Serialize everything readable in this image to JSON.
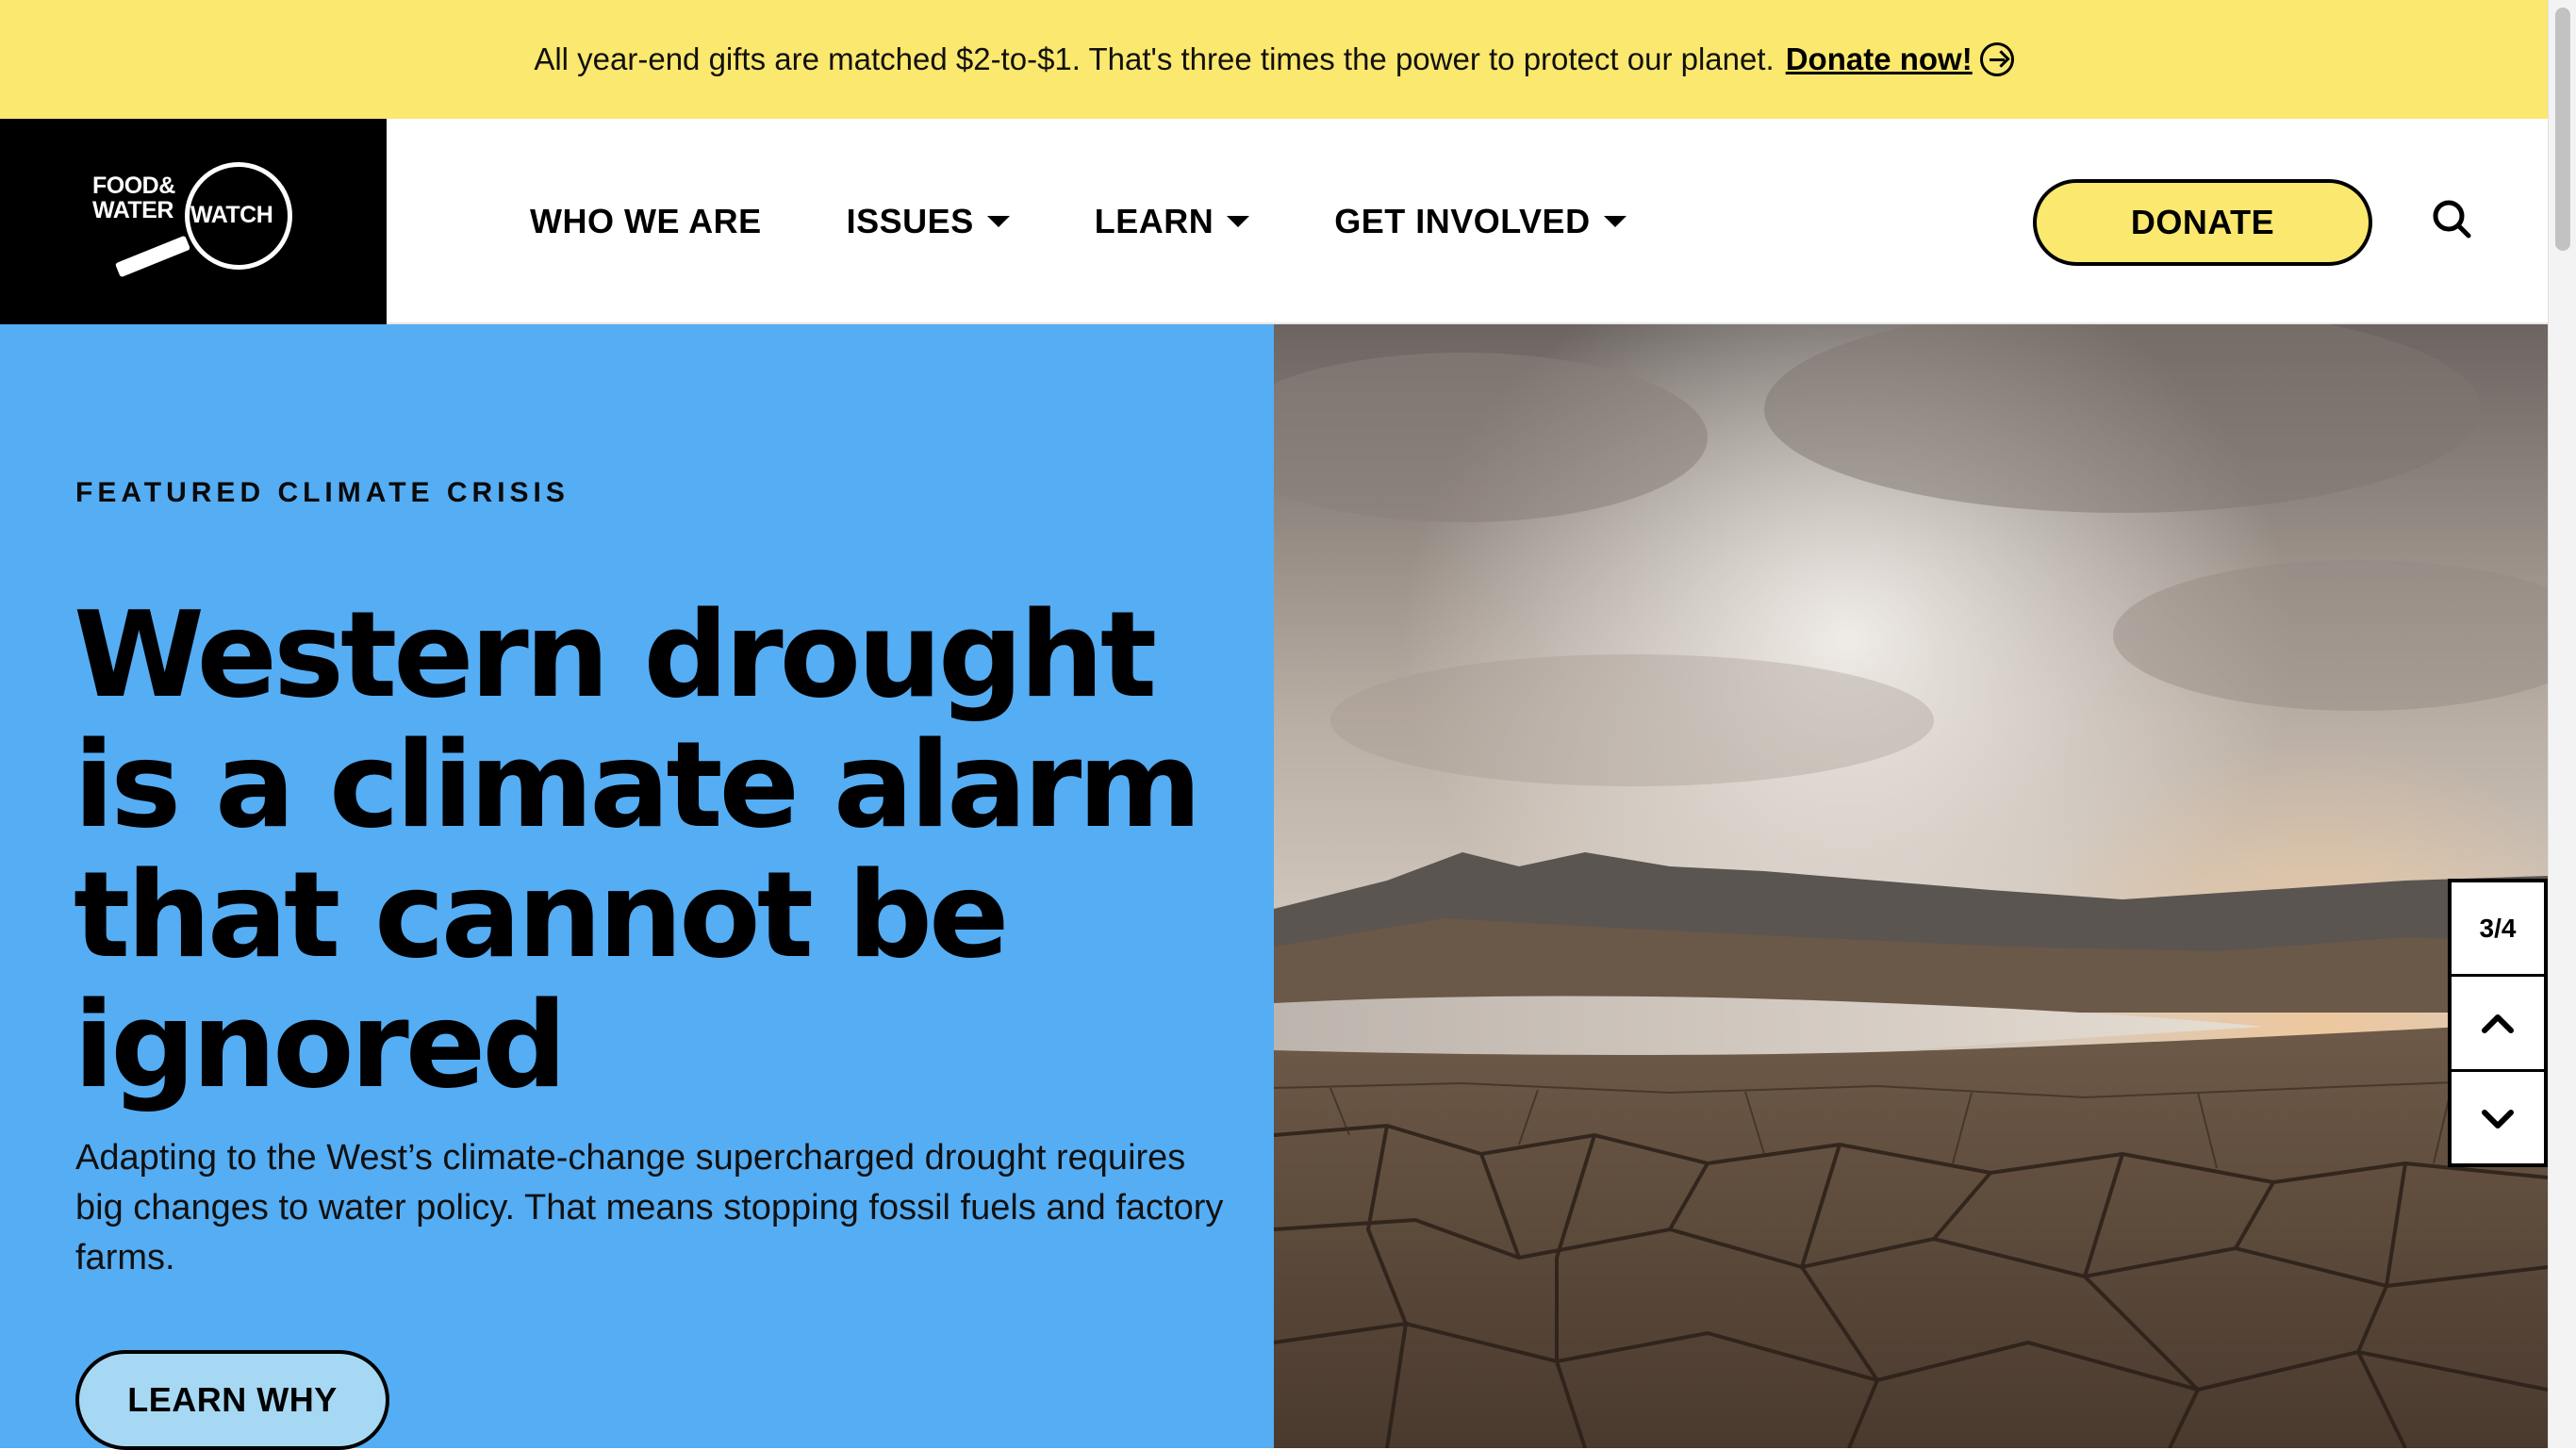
{
  "banner": {
    "message": "All year-end gifts are matched $2-to-$1. That's three times the power to protect our planet.",
    "cta_label": "Donate now!",
    "cta_icon": "arrow-right-circle-icon",
    "background": "#FBE86E"
  },
  "logo": {
    "line1": "FOOD&",
    "line2": "WATER",
    "ring_text": "WATCH"
  },
  "nav": {
    "items": [
      {
        "label": "WHO WE ARE",
        "has_dropdown": false
      },
      {
        "label": "ISSUES",
        "has_dropdown": true
      },
      {
        "label": "LEARN",
        "has_dropdown": true
      },
      {
        "label": "GET INVOLVED",
        "has_dropdown": true
      }
    ],
    "donate_label": "DONATE",
    "search_icon": "search-icon"
  },
  "hero": {
    "eyebrow": "FEATURED CLIMATE CRISIS",
    "headline": "Western drought is a climate alarm that cannot be ignored",
    "summary": "Adapting to the West’s climate-change supercharged drought requires big changes to water policy. That means stopping fossil fuels and factory farms.",
    "cta_label": "LEARN WHY",
    "panel_color": "#55ADF4",
    "button_color": "#A6D8F3"
  },
  "slider": {
    "counter": "3/4",
    "prev_icon": "chevron-up-icon",
    "next_icon": "chevron-down-icon"
  }
}
